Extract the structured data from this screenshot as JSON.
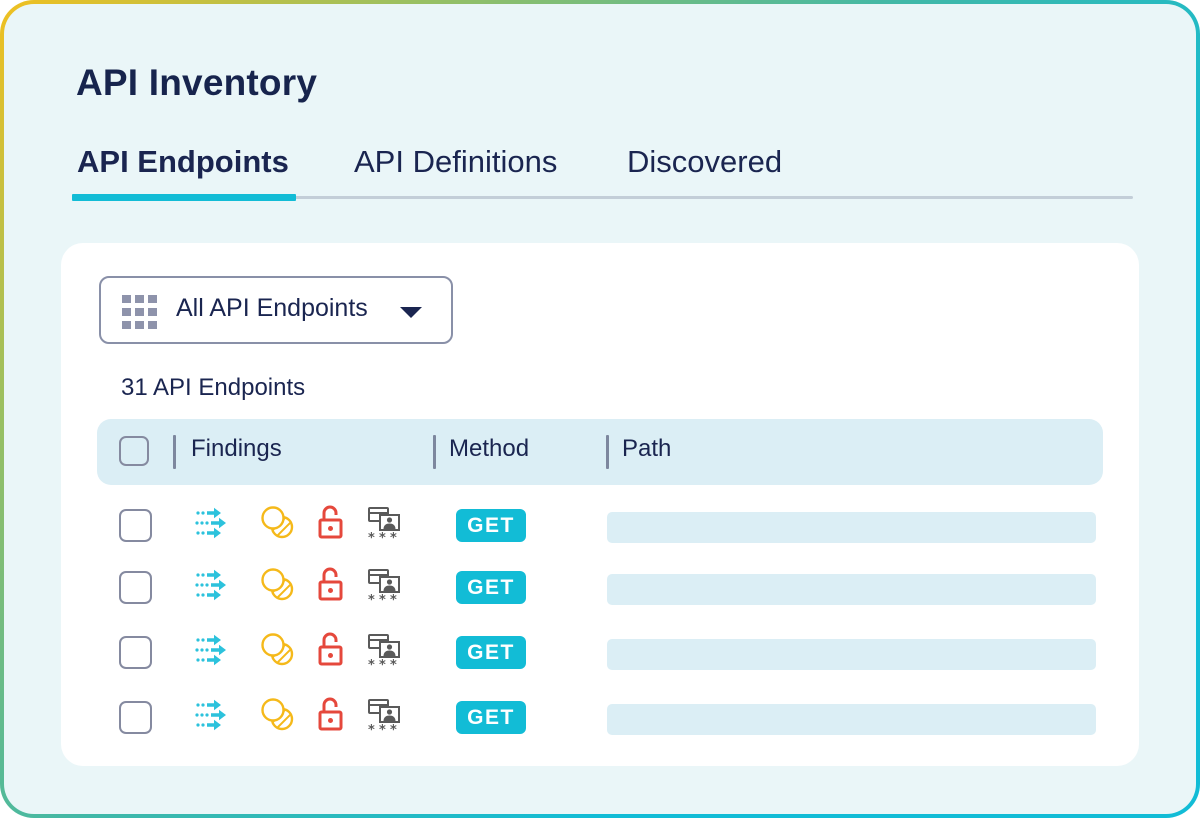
{
  "page": {
    "title": "API Inventory"
  },
  "tabs": [
    {
      "label": "API Endpoints",
      "active": true
    },
    {
      "label": "API Definitions",
      "active": false
    },
    {
      "label": "Discovered",
      "active": false
    }
  ],
  "filter": {
    "selected": "All API Endpoints",
    "icon": "grid-icon"
  },
  "summary": {
    "count_label": "31 API Endpoints"
  },
  "table": {
    "columns": [
      "Findings",
      "Method",
      "Path"
    ],
    "rows": [
      {
        "findings": [
          "data-flow-icon",
          "overlap-circles-icon",
          "unlocked-icon",
          "credentials-icon"
        ],
        "method": "GET",
        "path": ""
      },
      {
        "findings": [
          "data-flow-icon",
          "overlap-circles-icon",
          "unlocked-icon",
          "credentials-icon"
        ],
        "method": "GET",
        "path": ""
      },
      {
        "findings": [
          "data-flow-icon",
          "overlap-circles-icon",
          "unlocked-icon",
          "credentials-icon"
        ],
        "method": "GET",
        "path": ""
      },
      {
        "findings": [
          "data-flow-icon",
          "overlap-circles-icon",
          "unlocked-icon",
          "credentials-icon"
        ],
        "method": "GET",
        "path": ""
      }
    ]
  },
  "colors": {
    "accent": "#12bcd6",
    "text": "#1a2550",
    "warning": "#f5b91a",
    "danger": "#e5483c",
    "neutral": "#5a5a5a",
    "header_bg": "#dbeef5",
    "page_bg": "#eaf6f8"
  }
}
